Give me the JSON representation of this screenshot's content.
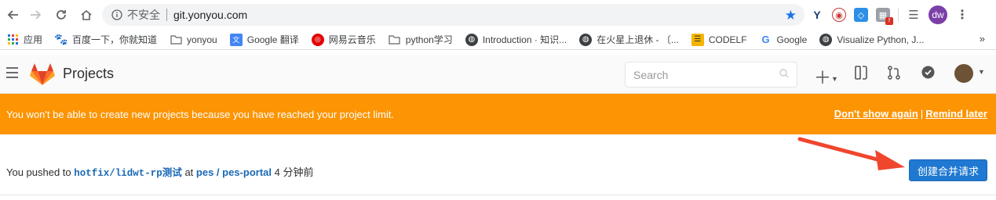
{
  "browser": {
    "insecure_label": "不安全",
    "url": "git.yonyou.com",
    "profile_initials": "dw"
  },
  "bookmarks": [
    {
      "label": "应用",
      "icon": "apps-grid-icon"
    },
    {
      "label": "百度一下，你就知道",
      "icon": "baidu-paw-icon"
    },
    {
      "label": "yonyou",
      "icon": "folder-icon"
    },
    {
      "label": "Google 翻译",
      "icon": "translate-icon"
    },
    {
      "label": "网易云音乐",
      "icon": "netease-music-icon"
    },
    {
      "label": "python学习",
      "icon": "folder-icon"
    },
    {
      "label": "Introduction · 知识...",
      "icon": "globe-icon"
    },
    {
      "label": "在火星上退休 - 〔...",
      "icon": "globe-icon"
    },
    {
      "label": "CODELF",
      "icon": "codelf-icon"
    },
    {
      "label": "Google",
      "icon": "google-g-icon"
    },
    {
      "label": "Visualize Python, J...",
      "icon": "globe-icon"
    }
  ],
  "bookmarks_more": "»",
  "header": {
    "title": "Projects",
    "search_placeholder": "Search"
  },
  "alert": {
    "message": "You won't be able to create new projects because you have reached your project limit.",
    "dont_show": "Don't show again",
    "separator": "|",
    "remind_later": "Remind later"
  },
  "event": {
    "prefix": "You pushed to",
    "branch": "hotfix/lidwt-rp测试",
    "at": "at",
    "project": "pes / pes-portal",
    "time": "4 分钟前",
    "button": "创建合并请求"
  },
  "colors": {
    "alert_bg": "#fc9403",
    "primary_button": "#1f78d1",
    "link": "#1b69b6",
    "annotation_arrow": "#f0462d"
  }
}
